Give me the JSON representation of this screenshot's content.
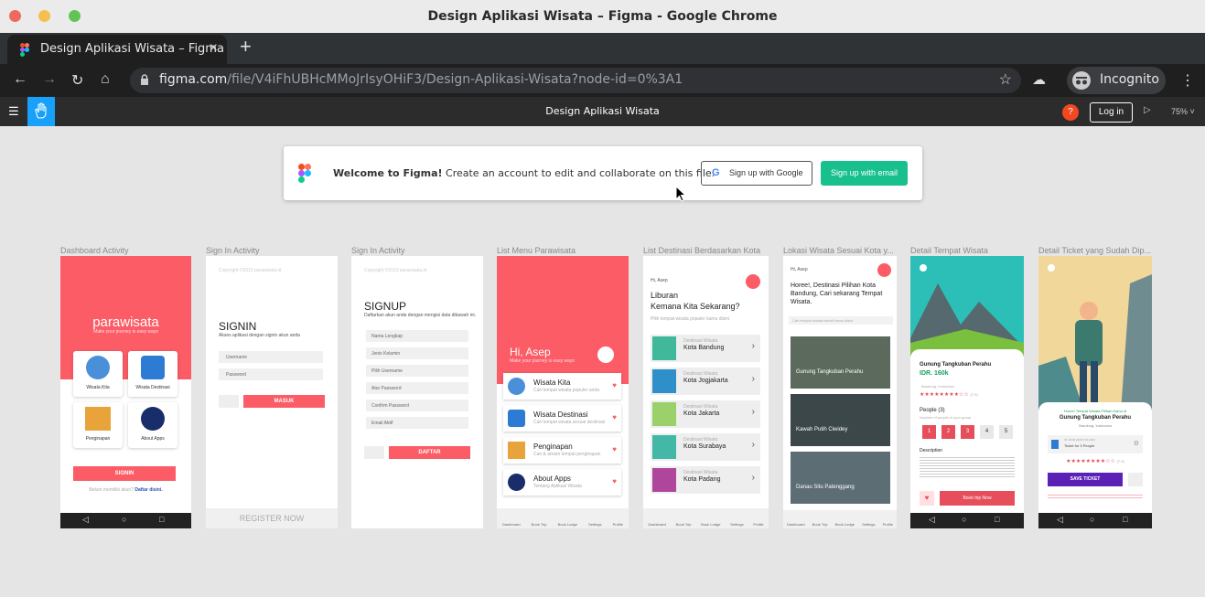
{
  "window": {
    "title": "Design Aplikasi Wisata – Figma - Google Chrome"
  },
  "tab": {
    "title": "Design Aplikasi Wisata – Figma",
    "close": "×",
    "new": "+"
  },
  "address": {
    "host": "figma.com",
    "path": "/file/V4iFhUBHcMMoJrIsyOHiF3/Design-Aplikasi-Wisata?node-id=0%3A1"
  },
  "incognito": "Incognito",
  "figma": {
    "doc_title": "Design Aplikasi Wisata",
    "login": "Log in",
    "zoom": "75%",
    "help": "?"
  },
  "banner": {
    "welcome": "Welcome to Figma!",
    "message": "Create an account to edit and collaborate on this file.",
    "google": "Sign up with Google",
    "email": "Sign up with email"
  },
  "frames": [
    "Dashboard Activity",
    "Sign In Activity",
    "Sign In Activity",
    "List Menu Parawisata",
    "List Destinasi Berdasarkan Kota",
    "Lokasi Wisata Sesuai Kota y...",
    "Detail Tempat Wisata",
    "Detail Ticket yang Sudah Dip..."
  ],
  "f1": {
    "brand": "parawisata",
    "sub": "Make your journey is easy ways",
    "tiles": [
      "Wisata Kita",
      "Wisata Destinasi",
      "Penginapan",
      "About Apps"
    ],
    "signin": "SIGNIN",
    "foot1": "Belum memiliki akun?",
    "foot2": "Daftar disini."
  },
  "f2": {
    "copy": "Copyright ©2019 parawisata.id",
    "title": "SIGNIN",
    "sub": "Akses aplikasi dengan signin akun anda",
    "user": "Username",
    "pass": "Password",
    "btn": "MASUK",
    "reg": "REGISTER NOW"
  },
  "f3": {
    "copy": "Copyright ©2019 parawisata.id",
    "title": "SIGNUP",
    "sub": "Daftarkan akun anda dengan mengisi data dibawah ini.",
    "fields": [
      "Nama Lengkap",
      "Jenis Kelamin",
      "Pilih Username",
      "Atur Password",
      "Confirm Password",
      "Email Aktif"
    ],
    "btn": "DAFTAR"
  },
  "f4": {
    "hi": "Hi, Asep",
    "sub": "Make your journey is easy ways",
    "items": [
      {
        "t": "Wisata Kita",
        "s": "Cari tempat wisata populer anda"
      },
      {
        "t": "Wisata Destinasi",
        "s": "Cari tempat wisata sesuai destinasi"
      },
      {
        "t": "Penginapan",
        "s": "Cari & amam tempat penginapan"
      },
      {
        "t": "About Apps",
        "s": "Tentang Aplikasi Wisata"
      }
    ],
    "nav": [
      "Dashboard",
      "Book Trip",
      "Book Lodge",
      "Settings",
      "Profile"
    ]
  },
  "f5": {
    "hi": "Hi, Asep",
    "title1": "Liburan",
    "title2": "Kemana Kita Sekarang?",
    "sub": "Pilih tempat wisata populer kamu disini",
    "kicker": "Destinasi Wisata",
    "cities": [
      "Kota Bandung",
      "Kota Jogjakarta",
      "Kota Jakarta",
      "Kota Surabaya",
      "Kota Padang"
    ],
    "nav": [
      "Dashboard",
      "Book Trip",
      "Book Lodge",
      "Settings",
      "Profile"
    ]
  },
  "f6": {
    "hi": "Hi, Asep",
    "title": "Horee!, Destinasi Pilihan Kota Bandung, Cari sekarang Tempat Wisata.",
    "search": "Cari tempat wisata favorit kamu disini",
    "places": [
      "Gunung Tangkuban Perahu",
      "Kawah Putih Ciwidey",
      "Danau Situ Patenggang"
    ],
    "nav": [
      "Dashboard",
      "Book Trip",
      "Book Lodge",
      "Settings",
      "Profile"
    ]
  },
  "f7": {
    "name": "Gunung Tangkuban Perahu",
    "price": "IDR. 160k",
    "loc": "Bandung, Indonesia",
    "rating": "(7.9)",
    "people": "People (3)",
    "people_sub": "Number of people in your group",
    "counts": [
      "1",
      "2",
      "3",
      "4",
      "5"
    ],
    "desc": "Description",
    "btn": "Book trip Now"
  },
  "f8": {
    "kicker": "Horee! Tempat Wisata Pilihan Kamu di",
    "name": "Gunung Tangkuban Perahu",
    "loc": "Bandung, Indonesia",
    "date": "ID: 18.02.2020 5.19.2021",
    "ticket": "Ticket for 3 People",
    "rating": "(7.9)",
    "btn": "SAVE TICKET"
  }
}
